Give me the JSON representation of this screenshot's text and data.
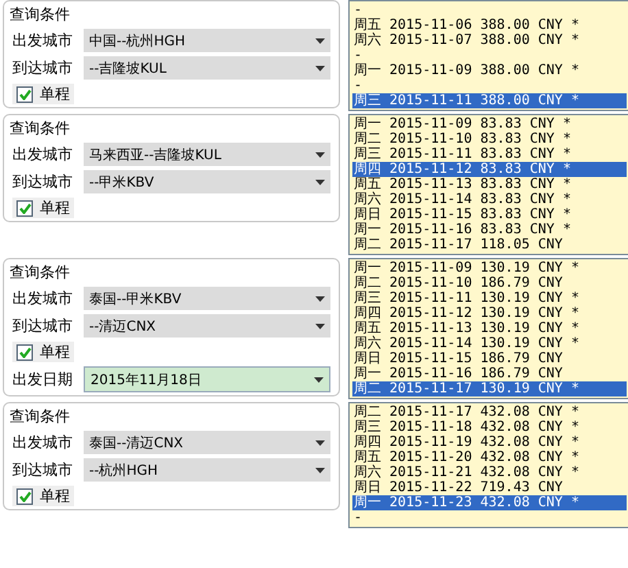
{
  "panels": [
    {
      "title": "查询条件",
      "departure": {
        "label": "出发城市",
        "value": "中国--杭州HGH"
      },
      "arrival": {
        "label": "到达城市",
        "value": "--吉隆坡KUL"
      },
      "one_way": {
        "label": "单程",
        "checked": true
      },
      "fares": [
        {
          "kind": "gap",
          "text": "-"
        },
        {
          "kind": "fare",
          "weekday": "周五",
          "date": "2015-11-06",
          "price": "388.00 CNY",
          "mark": "*",
          "selected": false
        },
        {
          "kind": "fare",
          "weekday": "周六",
          "date": "2015-11-07",
          "price": "388.00 CNY",
          "mark": "*",
          "selected": false
        },
        {
          "kind": "gap",
          "text": "-"
        },
        {
          "kind": "fare",
          "weekday": "周一",
          "date": "2015-11-09",
          "price": "388.00 CNY",
          "mark": "*",
          "selected": false
        },
        {
          "kind": "gap",
          "text": "-"
        },
        {
          "kind": "fare",
          "weekday": "周三",
          "date": "2015-11-11",
          "price": "388.00 CNY",
          "mark": "*",
          "selected": true
        }
      ]
    },
    {
      "title": "查询条件",
      "departure": {
        "label": "出发城市",
        "value": "马来西亚--吉隆坡KUL"
      },
      "arrival": {
        "label": "到达城市",
        "value": "--甲米KBV"
      },
      "one_way": {
        "label": "单程",
        "checked": true
      },
      "fares": [
        {
          "kind": "fare",
          "weekday": "周一",
          "date": "2015-11-09",
          "price": "83.83 CNY",
          "mark": "*",
          "selected": false
        },
        {
          "kind": "fare",
          "weekday": "周二",
          "date": "2015-11-10",
          "price": "83.83 CNY",
          "mark": "*",
          "selected": false
        },
        {
          "kind": "fare",
          "weekday": "周三",
          "date": "2015-11-11",
          "price": "83.83 CNY",
          "mark": "*",
          "selected": false
        },
        {
          "kind": "fare",
          "weekday": "周四",
          "date": "2015-11-12",
          "price": "83.83 CNY",
          "mark": "*",
          "selected": true
        },
        {
          "kind": "fare",
          "weekday": "周五",
          "date": "2015-11-13",
          "price": "83.83 CNY",
          "mark": "*",
          "selected": false
        },
        {
          "kind": "fare",
          "weekday": "周六",
          "date": "2015-11-14",
          "price": "83.83 CNY",
          "mark": "*",
          "selected": false
        },
        {
          "kind": "fare",
          "weekday": "周日",
          "date": "2015-11-15",
          "price": "83.83 CNY",
          "mark": "*",
          "selected": false
        },
        {
          "kind": "fare",
          "weekday": "周一",
          "date": "2015-11-16",
          "price": "83.83 CNY",
          "mark": "*",
          "selected": false
        },
        {
          "kind": "fare",
          "weekday": "周二",
          "date": "2015-11-17",
          "price": "118.05 CNY",
          "selected": false
        }
      ]
    },
    {
      "title": "查询条件",
      "departure": {
        "label": "出发城市",
        "value": "泰国--甲米KBV"
      },
      "arrival": {
        "label": "到达城市",
        "value": "--清迈CNX"
      },
      "one_way": {
        "label": "单程",
        "checked": true
      },
      "date": {
        "label": "出发日期",
        "value": "2015年11月18日"
      },
      "fares": [
        {
          "kind": "fare",
          "weekday": "周一",
          "date": "2015-11-09",
          "price": "130.19 CNY",
          "mark": "*",
          "selected": false
        },
        {
          "kind": "fare",
          "weekday": "周二",
          "date": "2015-11-10",
          "price": "186.79 CNY",
          "selected": false
        },
        {
          "kind": "fare",
          "weekday": "周三",
          "date": "2015-11-11",
          "price": "130.19 CNY",
          "mark": "*",
          "selected": false
        },
        {
          "kind": "fare",
          "weekday": "周四",
          "date": "2015-11-12",
          "price": "130.19 CNY",
          "mark": "*",
          "selected": false
        },
        {
          "kind": "fare",
          "weekday": "周五",
          "date": "2015-11-13",
          "price": "130.19 CNY",
          "mark": "*",
          "selected": false
        },
        {
          "kind": "fare",
          "weekday": "周六",
          "date": "2015-11-14",
          "price": "130.19 CNY",
          "mark": "*",
          "selected": false
        },
        {
          "kind": "fare",
          "weekday": "周日",
          "date": "2015-11-15",
          "price": "186.79 CNY",
          "selected": false
        },
        {
          "kind": "fare",
          "weekday": "周一",
          "date": "2015-11-16",
          "price": "186.79 CNY",
          "selected": false
        },
        {
          "kind": "fare",
          "weekday": "周二",
          "date": "2015-11-17",
          "price": "130.19 CNY",
          "mark": "*",
          "selected": true
        }
      ]
    },
    {
      "title": "查询条件",
      "departure": {
        "label": "出发城市",
        "value": "泰国--清迈CNX"
      },
      "arrival": {
        "label": "到达城市",
        "value": "--杭州HGH"
      },
      "one_way": {
        "label": "单程",
        "checked": true
      },
      "fares": [
        {
          "kind": "fare",
          "weekday": "周二",
          "date": "2015-11-17",
          "price": "432.08 CNY",
          "mark": "*",
          "selected": false
        },
        {
          "kind": "fare",
          "weekday": "周三",
          "date": "2015-11-18",
          "price": "432.08 CNY",
          "mark": "*",
          "selected": false
        },
        {
          "kind": "fare",
          "weekday": "周四",
          "date": "2015-11-19",
          "price": "432.08 CNY",
          "mark": "*",
          "selected": false
        },
        {
          "kind": "fare",
          "weekday": "周五",
          "date": "2015-11-20",
          "price": "432.08 CNY",
          "mark": "*",
          "selected": false
        },
        {
          "kind": "fare",
          "weekday": "周六",
          "date": "2015-11-21",
          "price": "432.08 CNY",
          "mark": "*",
          "selected": false
        },
        {
          "kind": "fare",
          "weekday": "周日",
          "date": "2015-11-22",
          "price": "719.43 CNY",
          "selected": false
        },
        {
          "kind": "fare",
          "weekday": "周一",
          "date": "2015-11-23",
          "price": "432.08 CNY",
          "mark": "*",
          "selected": true
        },
        {
          "kind": "gap",
          "text": "-"
        }
      ]
    }
  ]
}
